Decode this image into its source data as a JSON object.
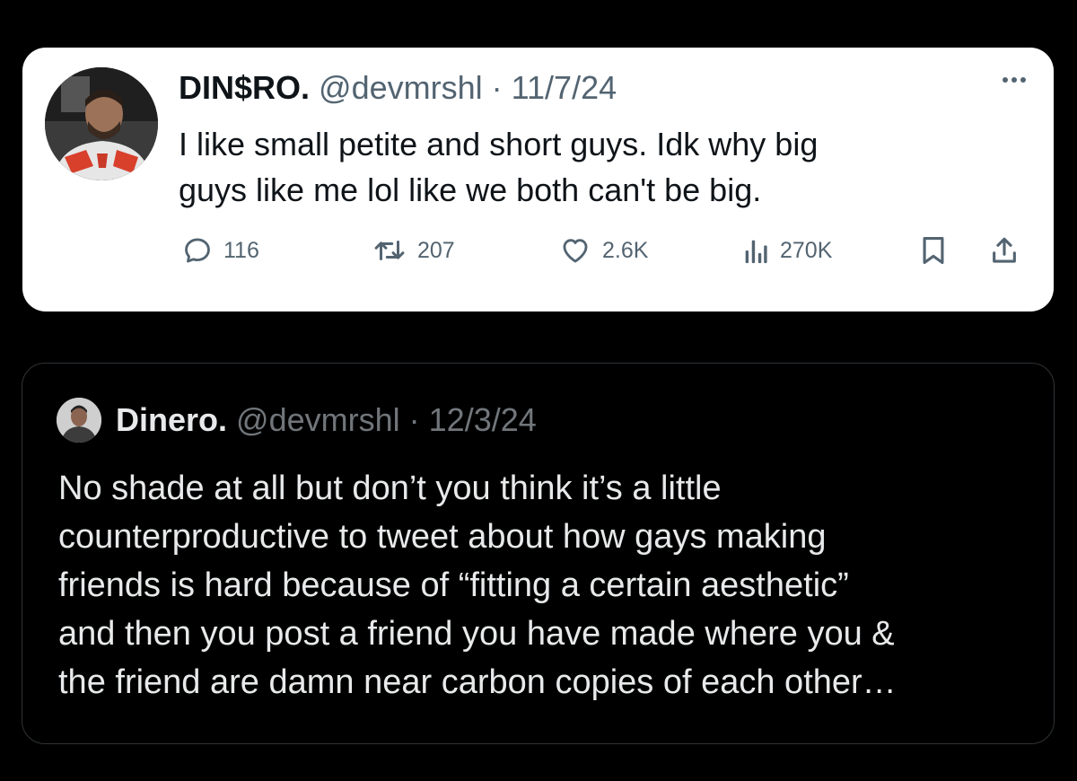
{
  "tweet1": {
    "name": "DIN$RO.",
    "handle": "@devmrshl",
    "separator": "·",
    "date": "11/7/24",
    "lines": [
      "I like small petite and short guys. Idk why big",
      "guys like me lol like we both can't be big."
    ],
    "actions": {
      "replies": "116",
      "reposts": "207",
      "likes": "2.6K",
      "views": "270K"
    },
    "icons": {
      "more": "more-dots-icon",
      "reply": "reply-bubble-icon",
      "repost": "repost-icon",
      "like": "heart-icon",
      "views": "views-chart-icon",
      "bookmark": "bookmark-icon",
      "share": "share-upload-icon"
    },
    "colors": {
      "text": "#0f1419",
      "muted": "#536471",
      "card": "#ffffff"
    }
  },
  "tweet2": {
    "name": "Dinero.",
    "handle": "@devmrshl",
    "separator": "·",
    "date": "12/3/24",
    "lines": [
      "No shade at all but don’t you think it’s a little",
      "counterproductive to tweet about how gays making",
      "friends is hard because of “fitting a certain aesthetic”",
      "and then you post a friend you have made where you &",
      "the friend are damn near carbon copies of each other…"
    ],
    "colors": {
      "text": "#e7e9ea",
      "muted": "#71767b",
      "border": "#2f3336"
    }
  }
}
